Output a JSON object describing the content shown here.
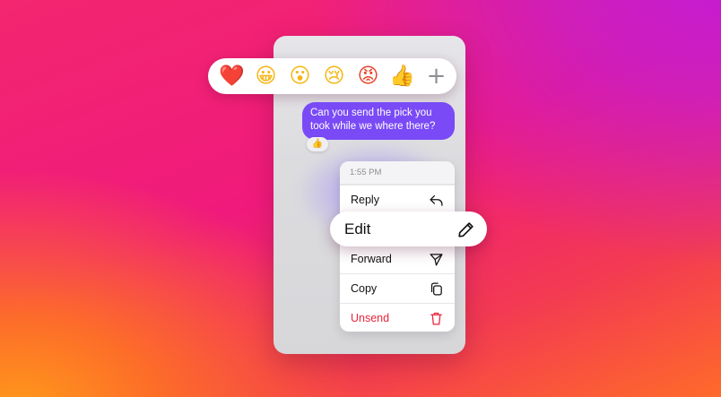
{
  "reactions": {
    "emojis": [
      {
        "icon": "red-heart-emoji",
        "glyph": "❤️"
      },
      {
        "icon": "grinning-face-emoji",
        "glyph": "😀"
      },
      {
        "icon": "surprised-face-emoji",
        "glyph": "😮"
      },
      {
        "icon": "crying-face-emoji",
        "glyph": "😢"
      },
      {
        "icon": "angry-face-emoji",
        "glyph": "😡"
      },
      {
        "icon": "thumbs-up-emoji",
        "glyph": "👍"
      }
    ],
    "more": {
      "icon": "plus-icon",
      "glyph": "+"
    }
  },
  "message": {
    "text": "Can you send the pick you took while we where there?",
    "reaction": {
      "icon": "thumbs-up-emoji",
      "glyph": "👍"
    },
    "bubble_color": "#7a4af7"
  },
  "menu": {
    "timestamp": "1:55 PM",
    "reply_label": "Reply",
    "edit_label": "Edit",
    "forward_label": "Forward",
    "copy_label": "Copy",
    "unsend_label": "Unsend",
    "destructive_color": "#e8243a"
  },
  "colors": {
    "background_pink": "#f3266f",
    "background_purple": "#c21cd6",
    "background_orange": "#ff9a1a"
  }
}
